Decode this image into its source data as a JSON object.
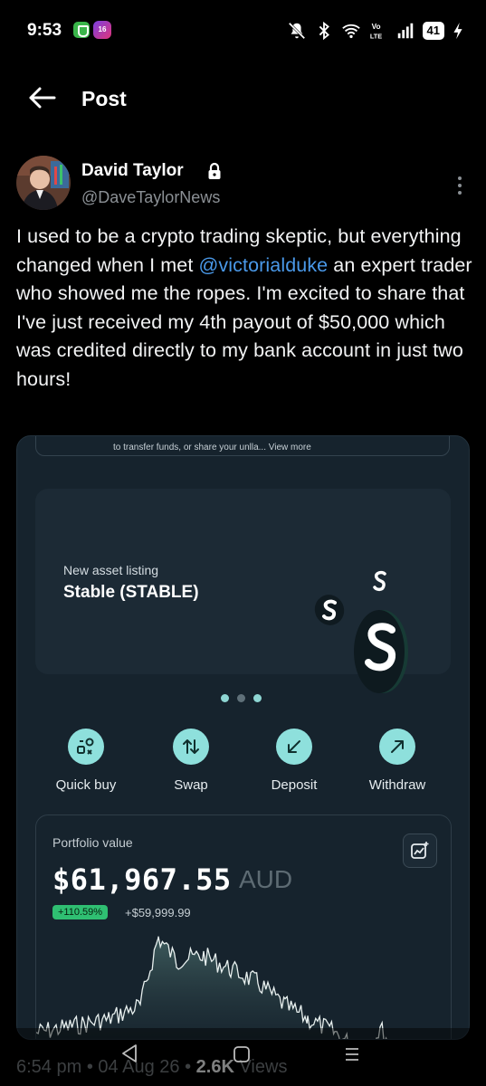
{
  "status_bar": {
    "time": "9:53",
    "notif_badge": "16",
    "battery": "41",
    "icons": [
      "shield-app-icon",
      "app-badge-icon",
      "mute-bell-icon",
      "bluetooth-icon",
      "wifi-icon",
      "volte-icon",
      "signal-icon",
      "battery-icon",
      "charging-icon"
    ]
  },
  "header": {
    "title": "Post",
    "back_icon": "arrow-left-icon"
  },
  "post": {
    "author_name": "David Taylor",
    "author_handle": "@DaveTaylorNews",
    "text_before": "I used to be a crypto trading skeptic, but everything changed when I met ",
    "mention": "@victorialduke",
    "text_after": " an expert trader who showed me the ropes. I'm excited to share that I've just received my 4th payout of $50,000 which was credited directly to my bank account in just two hours!",
    "time": "6:54 pm",
    "date": "04 Aug 26",
    "views_count": "2.6K",
    "views_label": "Views",
    "separator": "•"
  },
  "media": {
    "top_card_text": "to transfer funds, or share your unlla... View more",
    "banner": {
      "subtitle": "New asset listing",
      "title": "Stable (STABLE)"
    },
    "actions": [
      {
        "label": "Quick buy",
        "icon": "quick-buy-icon"
      },
      {
        "label": "Swap",
        "icon": "swap-icon"
      },
      {
        "label": "Deposit",
        "icon": "deposit-icon"
      },
      {
        "label": "Withdraw",
        "icon": "withdraw-icon"
      }
    ],
    "portfolio": {
      "label": "Portfolio value",
      "value": "$61,967.55",
      "currency": "AUD",
      "change_pct": "+110.59%",
      "change_amount": "+$59,999.99"
    },
    "colors": {
      "accent": "#8ee0dc",
      "positive": "#2fbf72",
      "card_bg": "#16232d"
    }
  }
}
